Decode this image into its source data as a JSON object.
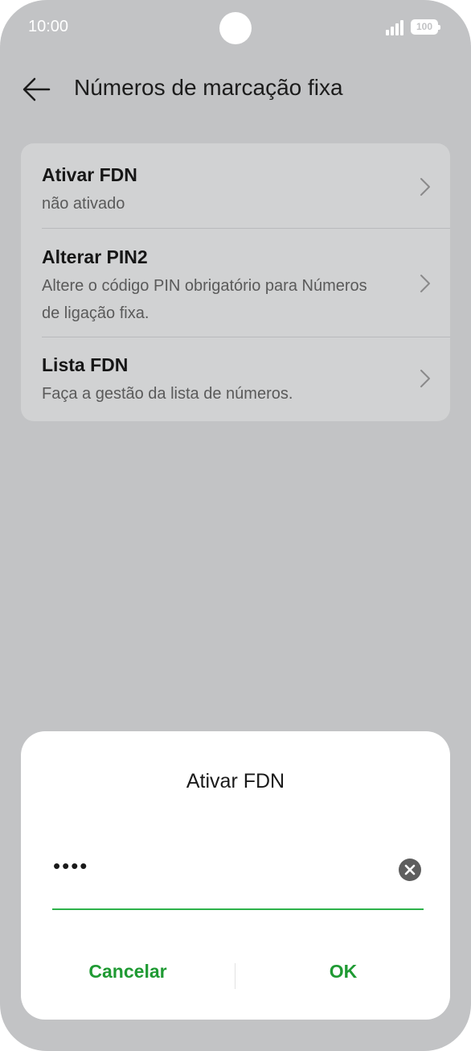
{
  "status_bar": {
    "time": "10:00",
    "battery": "100"
  },
  "header": {
    "title": "Números de marcação fixa"
  },
  "settings": [
    {
      "title": "Ativar FDN",
      "subtitle": "não ativado"
    },
    {
      "title": "Alterar PIN2",
      "subtitle": "Altere o código PIN obrigatório para Números de ligação fixa."
    },
    {
      "title": "Lista FDN",
      "subtitle": "Faça a gestão da lista de números."
    }
  ],
  "dialog": {
    "title": "Ativar FDN",
    "pin_value": "••••",
    "cancel_label": "Cancelar",
    "ok_label": "OK"
  },
  "colors": {
    "background": "#c2c3c5",
    "card": "#d1d2d3",
    "accent": "#1f9a33",
    "field_underline": "#2db24a"
  },
  "icons": [
    "back-arrow-icon",
    "chevron-right-icon",
    "clear-icon",
    "signal-icon",
    "battery-icon"
  ]
}
